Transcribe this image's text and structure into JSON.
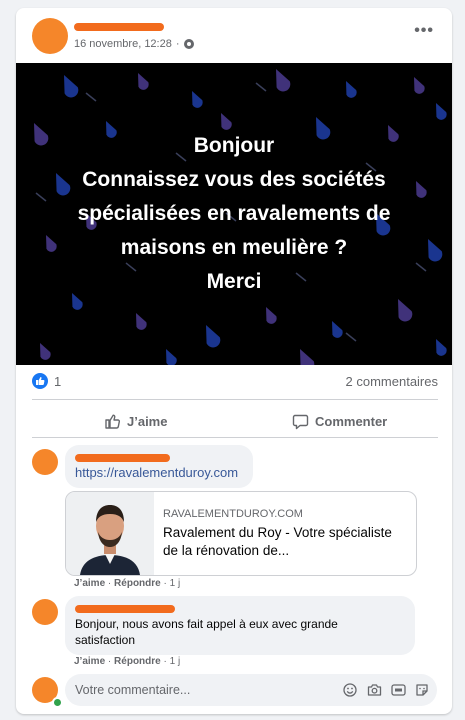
{
  "post": {
    "timestamp": "16 novembre, 12:28",
    "privacy_icon": "globe-icon",
    "more_label": "•••",
    "image_text": [
      "Bonjour",
      "Connaissez vous des sociétés",
      "spécialisées en ravalements de",
      "maisons en meulière ?",
      "Merci"
    ],
    "image_background": "#000000",
    "accent_drops": [
      "#4b3b8f",
      "#1f3ea8"
    ]
  },
  "stats": {
    "like_count": "1",
    "comments": "2 commentaires"
  },
  "actions": {
    "like_label": "J’aime",
    "comment_label": "Commenter"
  },
  "comments": [
    {
      "link": "https://ravalementduroy.com",
      "preview": {
        "domain": "RAVALEMENTDUROY.COM",
        "title": "Ravalement du Roy - Votre spécialiste de la rénovation de..."
      },
      "like_action": "J’aime",
      "reply_action": "Répondre",
      "age": "1 j"
    },
    {
      "text": "Bonjour, nous avons fait appel à eux avec grande satisfaction",
      "like_action": "J’aime",
      "reply_action": "Répondre",
      "age": "1 j"
    }
  ],
  "composer": {
    "placeholder": "Votre commentaire...",
    "icons": [
      "emoji-icon",
      "camera-icon",
      "gif-icon",
      "sticker-icon"
    ]
  },
  "colors": {
    "accent": "#1877f2",
    "redaction": "#f26b1d",
    "link": "#385898"
  }
}
